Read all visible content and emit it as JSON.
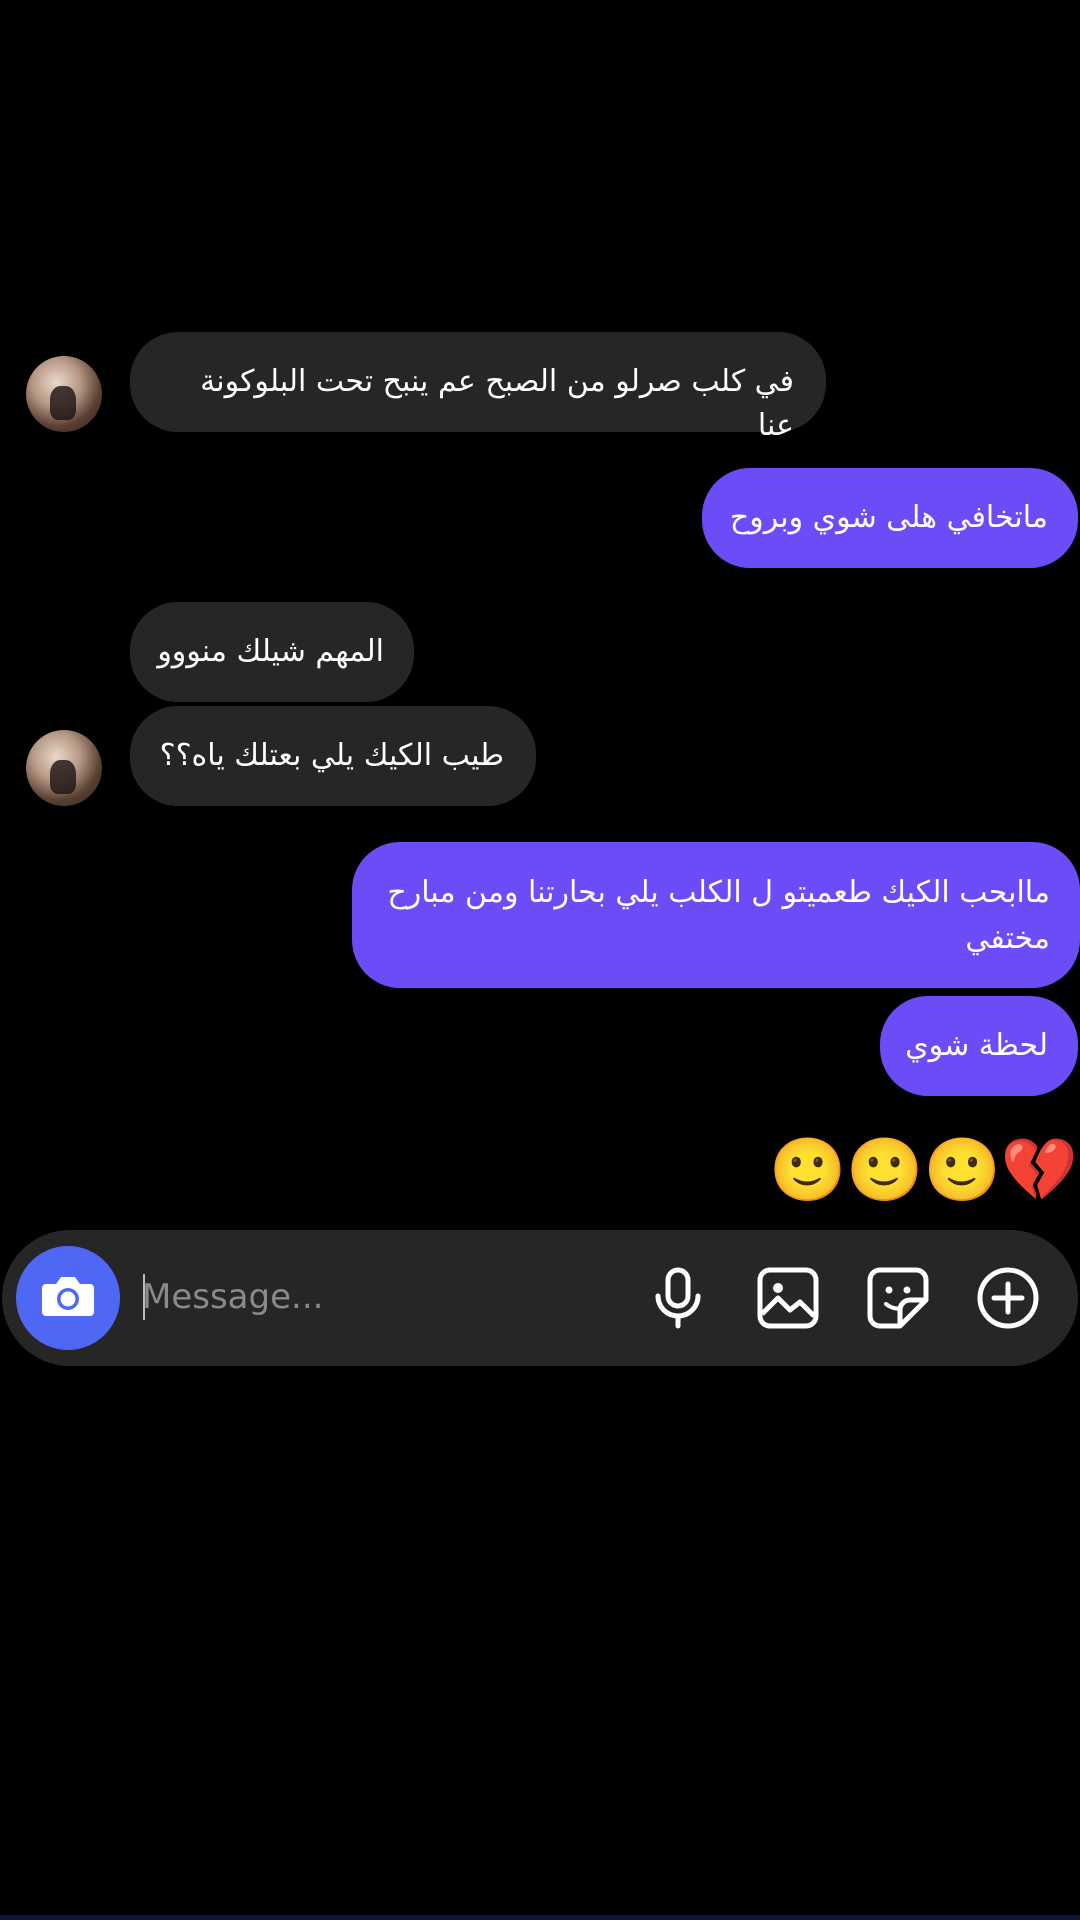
{
  "messages": [
    {
      "id": "m1",
      "direction": "in",
      "text": "في كلب صرلو من الصبح عم ينبح تحت البلوكونة عنا"
    },
    {
      "id": "m2",
      "direction": "out",
      "text": "ماتخافي هلى شوي وبروح"
    },
    {
      "id": "m3",
      "direction": "in",
      "text": "المهم شيلك منووو"
    },
    {
      "id": "m4",
      "direction": "in",
      "text": "طيب الكيك يلي بعتلك ياه؟؟"
    },
    {
      "id": "m5",
      "direction": "out",
      "text": "ماابحب الكيك طعميتو ل الكلب يلي بحارتنا ومن مبارح مختفي"
    },
    {
      "id": "m6",
      "direction": "out",
      "text": "لحظة شوي"
    }
  ],
  "reaction": {
    "emojis": [
      "💔",
      "🙂",
      "🙂",
      "🙂"
    ]
  },
  "composer": {
    "placeholder": "Message...",
    "camera_icon": "camera-icon",
    "mic_icon": "microphone-icon",
    "gallery_icon": "gallery-icon",
    "sticker_icon": "sticker-icon",
    "add_icon": "plus-circle-icon"
  },
  "colors": {
    "background": "#000000",
    "incoming_bubble": "#262626",
    "outgoing_bubble": "#6b4cf6",
    "camera_button": "#4e68f5"
  }
}
